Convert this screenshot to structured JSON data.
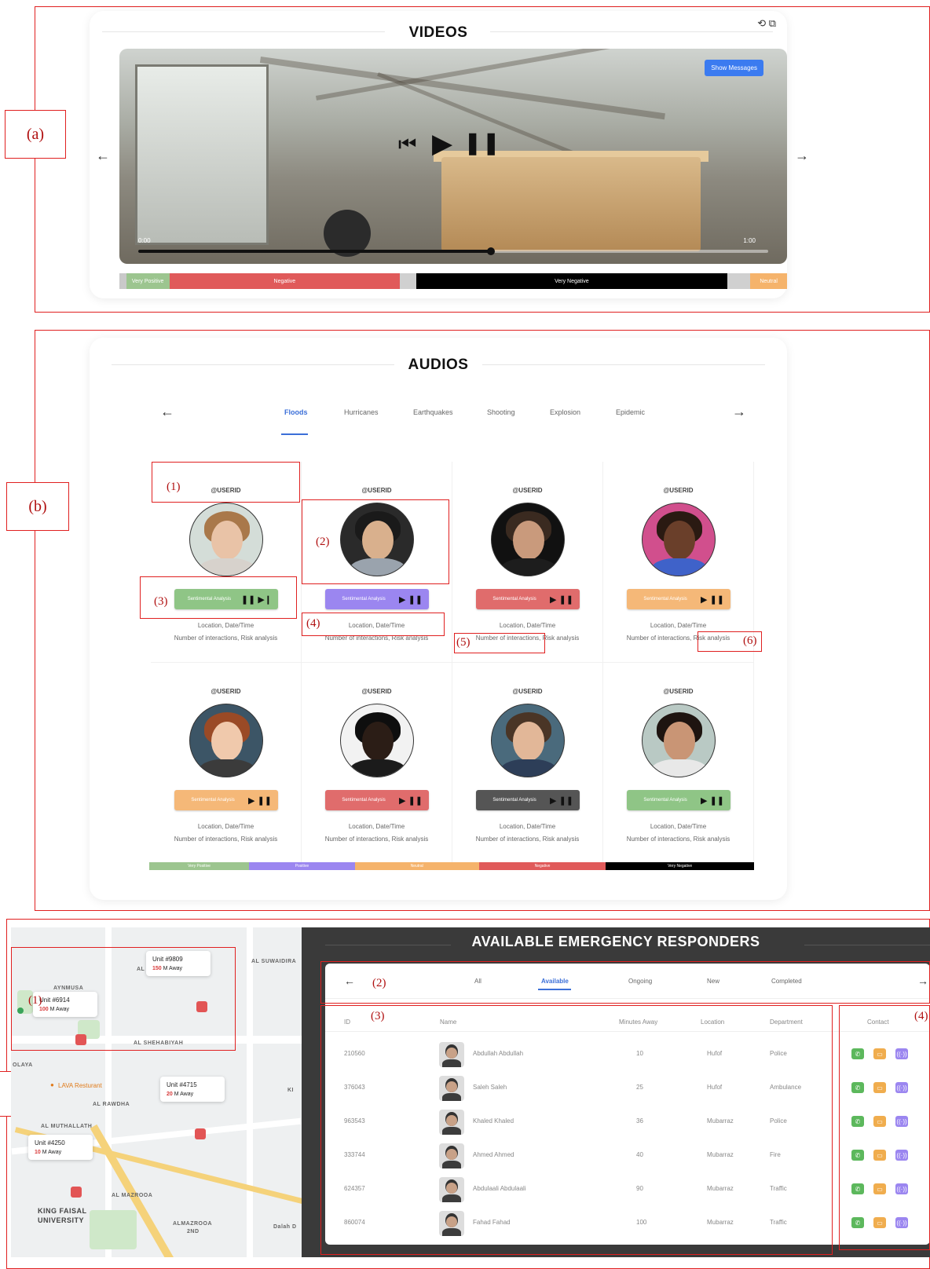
{
  "annotations": {
    "panel_a": "(a)",
    "panel_b": "(b)",
    "panel_c": "c)",
    "b_notes": [
      "(1)",
      "(2)",
      "(3)",
      "(4)",
      "(5)",
      "(6)"
    ],
    "c_notes": [
      "(1)",
      "(2)",
      "(3)",
      "(4)"
    ]
  },
  "videos": {
    "title": "VIDEOS",
    "show_messages": "Show Messages",
    "time_start": "0:00",
    "time_end": "1:00",
    "progress": 0.56,
    "sentiment_bar": [
      {
        "label": "",
        "color": "#c9c9c9",
        "share": 0.01
      },
      {
        "label": "Very Positive",
        "color": "#9cc58f",
        "share": 0.065
      },
      {
        "label": "Negative",
        "color": "#e05a5a",
        "share": 0.345
      },
      {
        "label": "",
        "color": "#d0d0d0",
        "share": 0.025
      },
      {
        "label": "Very Negative",
        "color": "#000000",
        "share": 0.465
      },
      {
        "label": "",
        "color": "#d0d0d0",
        "share": 0.035
      },
      {
        "label": "Neutral",
        "color": "#f5b36b",
        "share": 0.055
      }
    ]
  },
  "audios": {
    "title": "AUDIOS",
    "tabs": [
      "Floods",
      "Hurricanes",
      "Earthquakes",
      "Shooting",
      "Explosion",
      "Epidemic"
    ],
    "active_tab": "Floods",
    "cards": [
      {
        "user": "@USERID",
        "btn": "Sentimental Analysis",
        "color": "#8fc586",
        "controls": "❚❚ ▶❙",
        "face": "#e9c3a7",
        "hair": "#a9784a",
        "body": "#d7d2cc",
        "bg": "#d4ddd8",
        "meta1": "Location, Date/Time",
        "meta2": "Number of interactions, Risk analysis"
      },
      {
        "user": "@USERID",
        "btn": "Sentimental Analysis",
        "color": "#9b86f0",
        "controls": "▶ ❚❚",
        "face": "#d9b08d",
        "hair": "#1a1a1a",
        "body": "#9aa3ad",
        "bg": "#2a2a2a",
        "meta1": "Location, Date/Time",
        "meta2": "Number of interactions, Risk analysis"
      },
      {
        "user": "@USERID",
        "btn": "Sentimental Analysis",
        "color": "#e06c6c",
        "controls": "▶ ❚❚",
        "face": "#c99a7c",
        "hair": "#3a2a20",
        "body": "#1d1d1d",
        "bg": "#111111",
        "meta1": "Location, Date/Time",
        "meta2": "Number of interactions, Risk analysis"
      },
      {
        "user": "@USERID",
        "btn": "Sentimental Analysis",
        "color": "#f5b878",
        "controls": "▶ ❚❚",
        "face": "#6a3f2a",
        "hair": "#2a1a12",
        "body": "#3f62c9",
        "bg": "#d14f8d",
        "meta1": "Location, Date/Time",
        "meta2": "Number of interactions, Risk analysis"
      },
      {
        "user": "@USERID",
        "btn": "Sentimental Analysis",
        "color": "#f5b878",
        "controls": "▶ ❚❚",
        "face": "#f0c9ac",
        "hair": "#9a4a26",
        "body": "#3b3b3b",
        "bg": "#3c5566",
        "meta1": "Location, Date/Time",
        "meta2": "Number of interactions, Risk analysis"
      },
      {
        "user": "@USERID",
        "btn": "Sentimental Analysis",
        "color": "#e06c6c",
        "controls": "▶ ❚❚",
        "face": "#2b1d16",
        "hair": "#0e0e0e",
        "body": "#1b1b1b",
        "bg": "#f2f2f2",
        "meta1": "Location, Date/Time",
        "meta2": "Number of interactions, Risk analysis"
      },
      {
        "user": "@USERID",
        "btn": "Sentimental Analysis",
        "color": "#555555",
        "controls": "▶ ❚❚",
        "face": "#e2b798",
        "hair": "#4a3526",
        "body": "#2d3e58",
        "bg": "#4a6a7c",
        "meta1": "Location, Date/Time",
        "meta2": "Number of interactions, Risk analysis"
      },
      {
        "user": "@USERID",
        "btn": "Sentimental Analysis",
        "color": "#8fc586",
        "controls": "▶ ❚❚",
        "face": "#c99575",
        "hair": "#1e1410",
        "body": "#e8e8e8",
        "bg": "#b9c9c4",
        "meta1": "Location, Date/Time",
        "meta2": "Number of interactions, Risk analysis"
      }
    ],
    "legend": [
      {
        "label": "Very Positive",
        "color": "#9cc58f",
        "share": 0.165
      },
      {
        "label": "Positive",
        "color": "#9b86f0",
        "share": 0.175
      },
      {
        "label": "Neutral",
        "color": "#f5b36b",
        "share": 0.205
      },
      {
        "label": "Negative",
        "color": "#e05a5a",
        "share": 0.21
      },
      {
        "label": "Very Negative",
        "color": "#000000",
        "share": 0.245
      }
    ]
  },
  "map": {
    "units": [
      {
        "unit": "Unit #9809",
        "dist": "150",
        "suffix": "M Away"
      },
      {
        "unit": "Unit #6914",
        "dist": "100",
        "suffix": "M Away"
      },
      {
        "unit": "Unit #4715",
        "dist": "20",
        "suffix": "M Away"
      },
      {
        "unit": "Unit #4250",
        "dist": "10",
        "suffix": "M Away"
      }
    ],
    "districts": [
      "AYNMUSA",
      "AL SHEHABIYAH",
      "AL SUWAIDIRA",
      "OLAYA",
      "AL RAWDHA",
      "AL MUTHALLATH",
      "AL MAZROOA",
      "KING FAISAL",
      "UNIVERSITY",
      "ALMAZROOA",
      "2ND",
      "AL",
      "KI",
      "Dalah D"
    ],
    "poi": "LAVA Resturant"
  },
  "responders": {
    "title": "AVAILABLE EMERGENCY RESPONDERS",
    "tabs": [
      "All",
      "Available",
      "Ongoing",
      "New",
      "Completed"
    ],
    "active_tab": "Available",
    "headers": {
      "id": "ID",
      "name": "Name",
      "minutes": "Minutes Away",
      "location": "Location",
      "department": "Department",
      "contact": "Contact"
    },
    "rows": [
      {
        "id": "210560",
        "name": "Abdullah Abdullah",
        "minutes": "10",
        "location": "Hufof",
        "department": "Police"
      },
      {
        "id": "376043",
        "name": "Saleh Saleh",
        "minutes": "25",
        "location": "Hufof",
        "department": "Ambulance"
      },
      {
        "id": "963543",
        "name": "Khaled Khaled",
        "minutes": "36",
        "location": "Mubarraz",
        "department": "Police"
      },
      {
        "id": "333744",
        "name": "Ahmed Ahmed",
        "minutes": "40",
        "location": "Mubarraz",
        "department": "Fire"
      },
      {
        "id": "624357",
        "name": "Abdulaali Abdulaali",
        "minutes": "90",
        "location": "Mubarraz",
        "department": "Traffic"
      },
      {
        "id": "860074",
        "name": "Fahad Fahad",
        "minutes": "100",
        "location": "Mubarraz",
        "department": "Traffic"
      }
    ],
    "contact_colors": {
      "call": "#5cb85c",
      "message": "#f0ad4e",
      "radio": "#9b86f0"
    }
  }
}
